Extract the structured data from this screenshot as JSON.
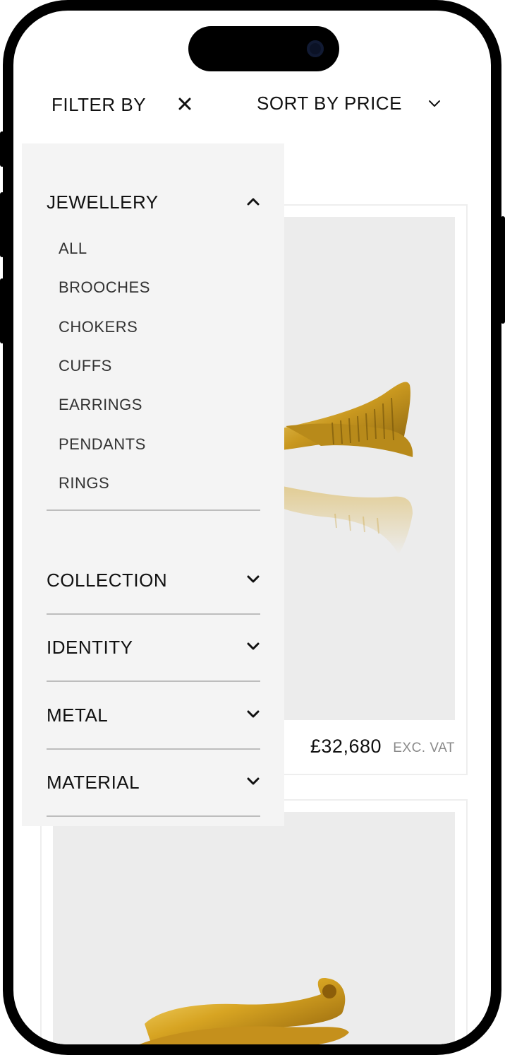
{
  "header": {
    "filter_label": "FILTER BY",
    "close_icon": "close-icon",
    "sort_label": "SORT BY PRICE",
    "sort_icon": "chevron-down-icon"
  },
  "filters": {
    "jewellery": {
      "label": "JEWELLERY",
      "expanded": true,
      "items": [
        "ALL",
        "BROOCHES",
        "CHOKERS",
        "CUFFS",
        "EARRINGS",
        "PENDANTS",
        "RINGS"
      ]
    },
    "collapsed_sections": [
      {
        "label": "COLLECTION"
      },
      {
        "label": "IDENTITY"
      },
      {
        "label": "METAL"
      },
      {
        "label": "MATERIAL"
      }
    ]
  },
  "products": [
    {
      "price": "£32,680",
      "vat_note": "EXC. VAT",
      "image": "gold twisted cuff"
    },
    {
      "image": "gold wave bangle"
    }
  ],
  "colors": {
    "panel_bg": "#f4f4f4",
    "image_bg": "#ececec",
    "gold": "#d4a62a",
    "text": "#111111"
  }
}
